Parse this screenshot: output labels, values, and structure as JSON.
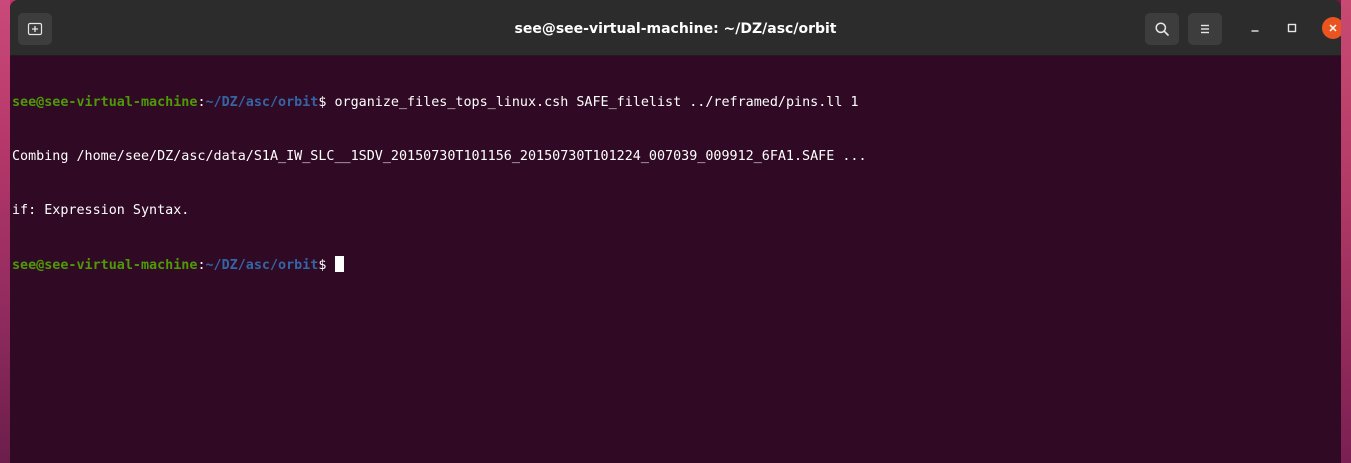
{
  "window": {
    "title": "see@see-virtual-machine: ~/DZ/asc/orbit"
  },
  "titlebar": {
    "new_tab_icon": "new-tab-icon",
    "search_icon": "search-icon",
    "menu_icon": "hamburger-menu-icon",
    "minimize_icon": "minimize-icon",
    "maximize_icon": "maximize-icon",
    "close_icon": "close-icon"
  },
  "colors": {
    "terminal_bg": "#300a24",
    "prompt_user": "#4e9a06",
    "prompt_path": "#3465a4",
    "close_button": "#e95420",
    "titlebar_bg": "#2c2c2c"
  },
  "terminal": {
    "line1": {
      "user_host": "see@see-virtual-machine",
      "colon": ":",
      "path": "~/DZ/asc/orbit",
      "dollar": "$",
      "command": " organize_files_tops_linux.csh SAFE_filelist ../reframed/pins.ll 1"
    },
    "line2": "Combing /home/see/DZ/asc/data/S1A_IW_SLC__1SDV_20150730T101156_20150730T101224_007039_009912_6FA1.SAFE ...",
    "line3": "if: Expression Syntax.",
    "line4": {
      "user_host": "see@see-virtual-machine",
      "colon": ":",
      "path": "~/DZ/asc/orbit",
      "dollar": "$",
      "command": " "
    }
  }
}
